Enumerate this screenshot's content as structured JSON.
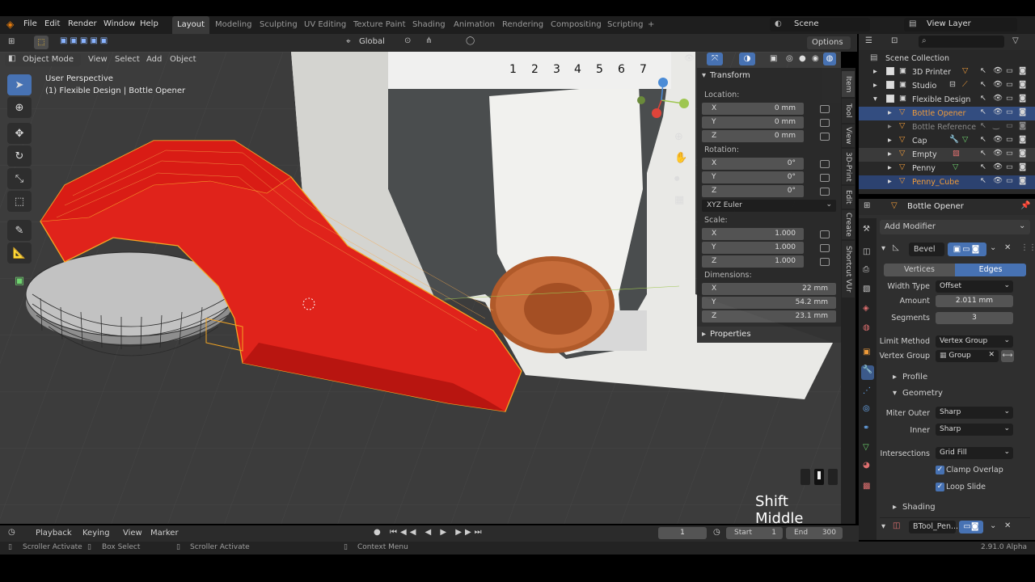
{
  "menu": {
    "file": "File",
    "edit": "Edit",
    "render": "Render",
    "window": "Window",
    "help": "Help"
  },
  "workspaces": [
    "Layout",
    "Modeling",
    "Sculpting",
    "UV Editing",
    "Texture Paint",
    "Shading",
    "Animation",
    "Rendering",
    "Compositing",
    "Scripting"
  ],
  "workspace_add": "+",
  "scene": {
    "name": "Scene",
    "view_layer": "View Layer"
  },
  "header": {
    "mode": "Object Mode",
    "view": "View",
    "select": "Select",
    "add": "Add",
    "object": "Object",
    "orientation": "Global",
    "options": "Options"
  },
  "viewport": {
    "perspective": "User Perspective",
    "context": "(1) Flexible Design | Bottle Opener",
    "overlay_text": "Shift Middle",
    "ruler_numbers": [
      "1",
      "2",
      "3",
      "4",
      "5",
      "6",
      "7"
    ]
  },
  "npanel": {
    "transform": "Transform",
    "location_label": "Location:",
    "location": [
      {
        "ax": "X",
        "v": "0 mm"
      },
      {
        "ax": "Y",
        "v": "0 mm"
      },
      {
        "ax": "Z",
        "v": "0 mm"
      }
    ],
    "rotation_label": "Rotation:",
    "rotation": [
      {
        "ax": "X",
        "v": "0°"
      },
      {
        "ax": "Y",
        "v": "0°"
      },
      {
        "ax": "Z",
        "v": "0°"
      }
    ],
    "rotation_mode": "XYZ Euler",
    "scale_label": "Scale:",
    "scale": [
      {
        "ax": "X",
        "v": "1.000"
      },
      {
        "ax": "Y",
        "v": "1.000"
      },
      {
        "ax": "Z",
        "v": "1.000"
      }
    ],
    "dimensions_label": "Dimensions:",
    "dimensions": [
      {
        "ax": "X",
        "v": "22 mm"
      },
      {
        "ax": "Y",
        "v": "54.2 mm"
      },
      {
        "ax": "Z",
        "v": "23.1 mm"
      }
    ],
    "properties": "Properties"
  },
  "sidetabs": [
    "Item",
    "Tool",
    "View",
    "3D-Print",
    "Edit",
    "Create",
    "Shortcut VUr"
  ],
  "outliner": {
    "title": "Scene Collection",
    "items": [
      {
        "label": "3D Printer",
        "sel": false
      },
      {
        "label": "Studio",
        "sel": false
      },
      {
        "label": "Flexible Design",
        "sel": false
      },
      {
        "label": "Bottle Opener",
        "sel": true
      },
      {
        "label": "Bottle Reference",
        "sel": false
      },
      {
        "label": "Cap",
        "sel": false
      },
      {
        "label": "Empty",
        "sel": false
      },
      {
        "label": "Penny",
        "sel": false
      },
      {
        "label": "Penny_Cube",
        "sel": true
      }
    ]
  },
  "properties": {
    "object_name": "Bottle Opener",
    "add_modifier": "Add Modifier",
    "modifier_name": "Bevel",
    "vertices": "Vertices",
    "edges": "Edges",
    "width_type_label": "Width Type",
    "width_type": "Offset",
    "amount_label": "Amount",
    "amount": "2.011 mm",
    "segments_label": "Segments",
    "segments": "3",
    "limit_method_label": "Limit Method",
    "limit_method": "Vertex Group",
    "vertex_group_label": "Vertex Group",
    "vertex_group": "Group",
    "profile": "Profile",
    "geometry": "Geometry",
    "miter_outer_label": "Miter Outer",
    "miter_outer": "Sharp",
    "inner_label": "Inner",
    "inner": "Sharp",
    "intersections_label": "Intersections",
    "intersections": "Grid Fill",
    "clamp_overlap": "Clamp Overlap",
    "loop_slide": "Loop Slide",
    "shading": "Shading",
    "modifier2": "BTool_Pen..."
  },
  "timeline": {
    "playback": "Playback",
    "keying": "Keying",
    "view": "View",
    "marker": "Marker",
    "frame": "1",
    "start_label": "Start",
    "start": "1",
    "end_label": "End",
    "end": "300"
  },
  "status": {
    "a": "Scroller Activate",
    "b": "Box Select",
    "c": "Scroller Activate",
    "d": "Context Menu",
    "version": "2.91.0 Alpha"
  },
  "colors": {
    "accent": "#4772b3",
    "object_red": "#e0241b",
    "selection_orange": "#f5a623"
  }
}
